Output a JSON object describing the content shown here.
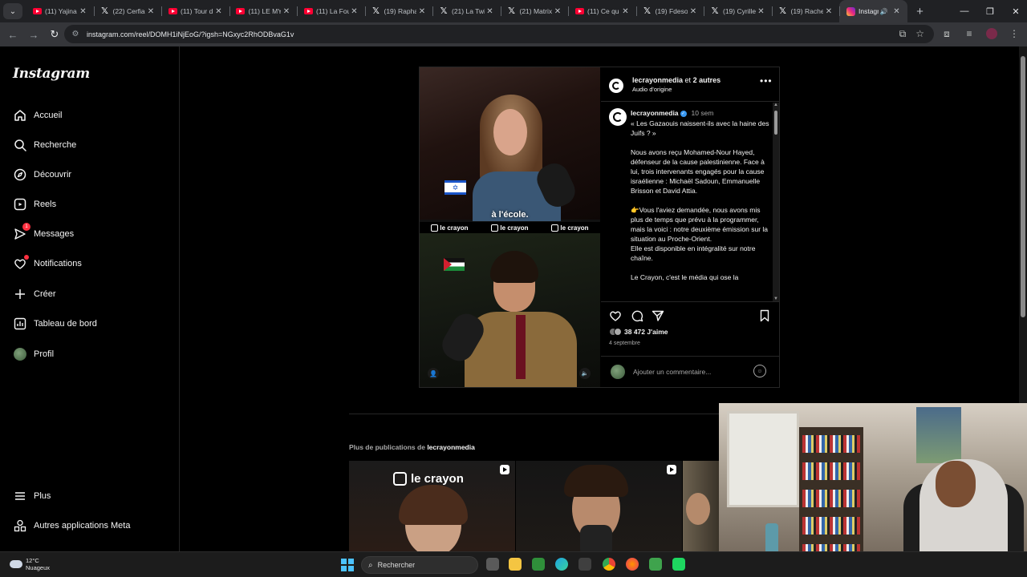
{
  "browser": {
    "tabs": [
      {
        "label": "(11) Yajina",
        "favicon": "youtube-icon"
      },
      {
        "label": "(22) Cerfia",
        "favicon": "x-icon"
      },
      {
        "label": "(11) Tour d",
        "favicon": "youtube-icon"
      },
      {
        "label": "(11) LE MY",
        "favicon": "youtube-icon"
      },
      {
        "label": "(11) La Fou",
        "favicon": "youtube-icon"
      },
      {
        "label": "(19) Rapha",
        "favicon": "x-icon"
      },
      {
        "label": "(21) La Twi",
        "favicon": "x-icon"
      },
      {
        "label": "(21) Matrix",
        "favicon": "x-icon"
      },
      {
        "label": "(11) Ce qu",
        "favicon": "youtube-icon"
      },
      {
        "label": "(19) Fdeso",
        "favicon": "x-icon"
      },
      {
        "label": "(19) Cyrille",
        "favicon": "x-icon"
      },
      {
        "label": "(19) Rache",
        "favicon": "x-icon"
      },
      {
        "label": "Instagr",
        "favicon": "instagram-icon",
        "active": true
      }
    ],
    "url": "instagram.com/reel/DOMH1iNjEoG/?igsh=NGxyc2RhODBvaG1v"
  },
  "sidebar": {
    "logo": "Instagram",
    "items": [
      {
        "label": "Accueil",
        "icon": "home-icon"
      },
      {
        "label": "Recherche",
        "icon": "search-icon"
      },
      {
        "label": "Découvrir",
        "icon": "compass-icon"
      },
      {
        "label": "Reels",
        "icon": "reels-icon"
      },
      {
        "label": "Messages",
        "icon": "messenger-icon",
        "badge": "1"
      },
      {
        "label": "Notifications",
        "icon": "heart-icon",
        "dot": true
      },
      {
        "label": "Créer",
        "icon": "plus-icon"
      },
      {
        "label": "Tableau de bord",
        "icon": "dashboard-icon"
      },
      {
        "label": "Profil",
        "icon": "profile-avatar"
      }
    ],
    "bottom_items": [
      {
        "label": "Plus",
        "icon": "menu-icon"
      },
      {
        "label": "Autres applications Meta",
        "icon": "meta-apps-icon"
      }
    ]
  },
  "post": {
    "media": {
      "caption": "à l'école.",
      "brand": "le crayon"
    },
    "header": {
      "username": "lecrayonmedia",
      "collab_connector": "et",
      "collab_count": "2 autres",
      "audio": "Audio d'origine"
    },
    "comment": {
      "username": "lecrayonmedia",
      "time": "10 sem",
      "text": "« Les Gazaouis naissent-ils avec la haine des Juifs ? »\n\nNous avons reçu Mohamed-Nour Hayed, défenseur de la cause palestinienne. Face à lui, trois intervenants engagés pour la cause israélienne : Michaël Sadoun, Emmanuelle Brisson et David Attia.\n\n👉Vous l'aviez demandée, nous avons mis plus de temps que prévu à la programmer, mais la voici : notre deuxième émission sur la situation au Proche-Orient.\nElle est disponible en intégralité sur notre chaîne.\n\nLe Crayon, c'est le média qui ose la"
    },
    "likes": "38 472 J'aime",
    "date": "4 septembre",
    "add_comment_placeholder": "Ajouter un commentaire..."
  },
  "more": {
    "prefix": "Plus de publications de",
    "username": "lecrayonmedia",
    "thumb_brand": "le crayon"
  },
  "taskbar": {
    "weather_temp": "12°C",
    "weather_desc": "Nuageux",
    "search_label": "Rechercher"
  },
  "colors": {
    "accent_badge": "#ff3040",
    "verified": "#3897f0",
    "background": "#000000"
  }
}
